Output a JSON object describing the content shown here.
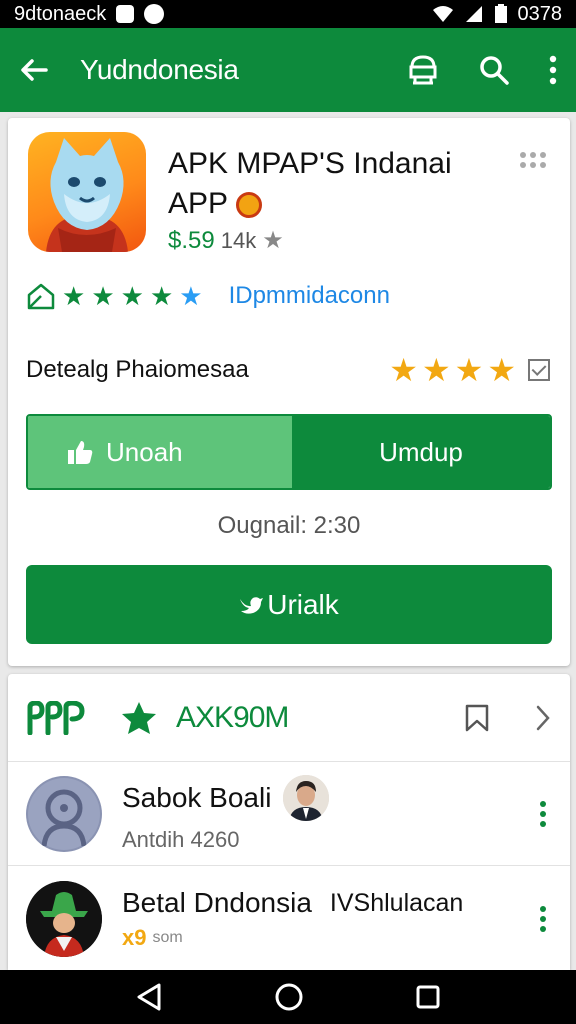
{
  "status_bar": {
    "left_text": "9dtonaeck",
    "time": "0378"
  },
  "app_bar": {
    "title": "Yudndonesia",
    "icons": [
      "back-arrow-icon",
      "shop-icon",
      "search-icon",
      "more-vert-icon"
    ]
  },
  "app_card": {
    "name": "APK MPAP'S Indanai APP",
    "price": "$.59",
    "reviews": "14k",
    "developer": "IDpmmidaconn",
    "rating_stars": {
      "filled": 4,
      "total": 5
    },
    "detail_label": "Detealg Phaiomesaa",
    "detail_stars": 4,
    "split_left_label": "Unoah",
    "split_right_label": "Umdup",
    "original_text": "Ougnail: 2:30",
    "install_label": "Urialk"
  },
  "section": {
    "title": "AXK90M",
    "items": [
      {
        "name": "Sabok Boali",
        "sub": "Antdih 4260"
      },
      {
        "name": "Betal Dndonsia",
        "name_extra": "IVShlulacan",
        "sub_mark": "x9",
        "sub": "som"
      }
    ]
  },
  "colors": {
    "brand_green": "#0d8a3c",
    "light_green": "#5ec47a",
    "star_orange": "#f2a812",
    "link_blue": "#1e88e5"
  }
}
